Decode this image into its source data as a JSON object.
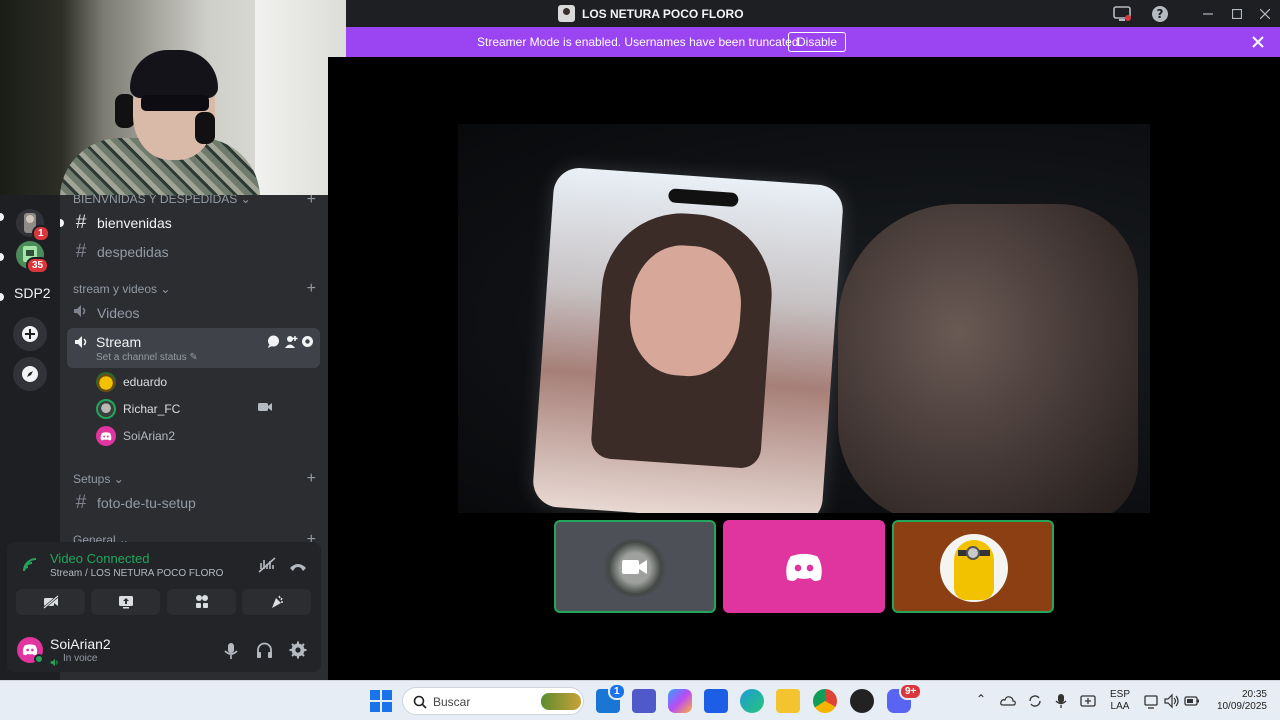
{
  "window": {
    "title": "LOS NETURA POCO FLORO"
  },
  "banner": {
    "text": "Streamer Mode is enabled. Usernames have been truncated.",
    "button": "Disable"
  },
  "servers": {
    "badges": [
      "1",
      "35"
    ],
    "text_server": "SDP2"
  },
  "channels": {
    "category_top": "BIENVNIDAS Y DESPEDIDAS",
    "text_channels": [
      "bienvenidas",
      "despedidas"
    ],
    "category_stream": "stream y videos",
    "voice_channels": [
      "Videos",
      "Stream"
    ],
    "stream_status": "Set a channel status",
    "voice_users": [
      "eduardo",
      "Richar_FC",
      "SoiArian2"
    ],
    "category_setups": "Setups",
    "setup_channel": "foto-de-tu-setup",
    "category_general": "General"
  },
  "voice_panel": {
    "title": "Video Connected",
    "subtitle": "Stream / LOS NETURA POCO FLORO"
  },
  "user": {
    "name": "SoiArian2",
    "status": "In voice"
  },
  "taskbar": {
    "search_placeholder": "Buscar",
    "lang_top": "ESP",
    "lang_bottom": "LAA",
    "time": "20:35",
    "date": "10/09/2025",
    "store_badge": "1",
    "discord_badge": "9+"
  },
  "colors": {
    "accent_purple": "#9b44f2",
    "connected_green": "#23a55a",
    "discord_pink": "#e0349e",
    "tile_brown": "#8b3f12"
  }
}
